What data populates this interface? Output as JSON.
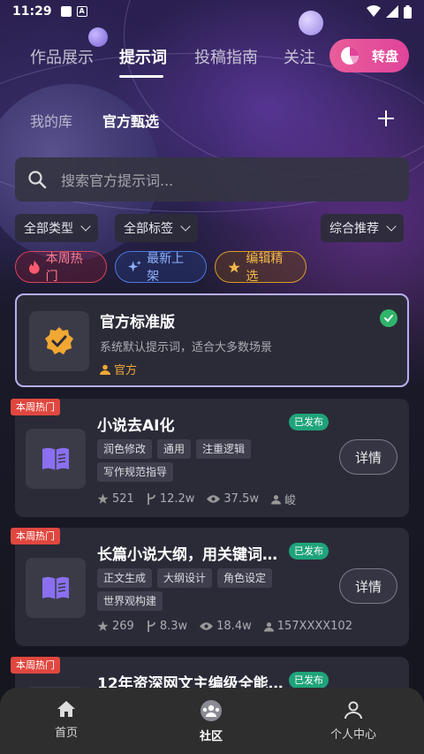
{
  "status_bar": {
    "time": "11:29"
  },
  "top_nav": {
    "tabs": [
      {
        "label": "作品展示"
      },
      {
        "label": "提示词"
      },
      {
        "label": "投稿指南"
      },
      {
        "label": "关注"
      }
    ],
    "active_tab": "提示词",
    "spin_button": "转盘"
  },
  "sub_tabs": {
    "items": [
      {
        "label": "我的库"
      },
      {
        "label": "官方甄选"
      }
    ],
    "active": "官方甄选"
  },
  "search": {
    "placeholder": "搜索官方提示词..."
  },
  "filters": {
    "type": "全部类型",
    "tags": "全部标签",
    "sort": "综合推荐"
  },
  "chips": {
    "hot": "本周热门",
    "new": "最新上架",
    "pick": "编辑精选"
  },
  "official_card": {
    "title": "官方标准版",
    "description": "系统默认提示词，适合大多数场景",
    "author": "官方"
  },
  "cards": [
    {
      "badge": "本周热门",
      "title": "小说去AI化",
      "status": "已发布",
      "tags": [
        "润色修改",
        "通用",
        "注重逻辑",
        "写作规范指导"
      ],
      "stars": "521",
      "forks": "12.2w",
      "views": "37.5w",
      "author": "峻",
      "detail": "详情"
    },
    {
      "badge": "本周热门",
      "title": "长篇小说大纲，用关键词…",
      "status": "已发布",
      "tags": [
        "正文生成",
        "大纲设计",
        "角色设定",
        "世界观构建"
      ],
      "stars": "269",
      "forks": "8.3w",
      "views": "18.4w",
      "author": "157XXXX102",
      "detail": "详情"
    },
    {
      "badge": "本周热门",
      "title": "12年资深网文主编级全能…",
      "status": "已发布"
    }
  ],
  "bottom_nav": {
    "items": [
      {
        "label": "首页"
      },
      {
        "label": "社区"
      },
      {
        "label": "个人中心"
      }
    ],
    "active": "社区"
  },
  "colors": {
    "accent_pink": "#e0449a",
    "published_green": "#1fa37a",
    "hot_red": "#e0473f",
    "official_orange": "#f0a832",
    "book_purple": "#8a6ff0"
  },
  "icons": {
    "status_left": [
      "image-icon",
      "a-icon"
    ],
    "status_right": [
      "wifi-icon",
      "signal-icon",
      "battery-icon"
    ]
  }
}
